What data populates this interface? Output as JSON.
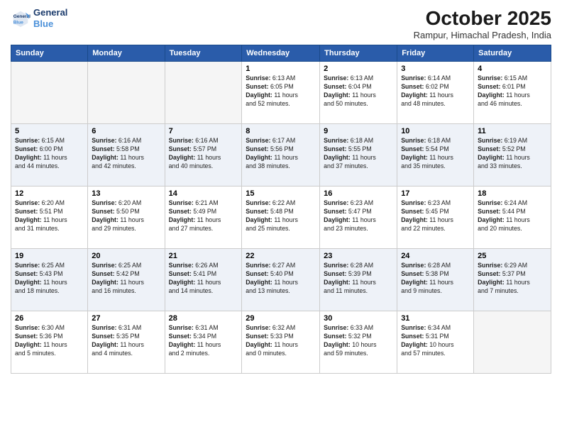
{
  "header": {
    "logo_line1": "General",
    "logo_line2": "Blue",
    "month": "October 2025",
    "location": "Rampur, Himachal Pradesh, India"
  },
  "weekdays": [
    "Sunday",
    "Monday",
    "Tuesday",
    "Wednesday",
    "Thursday",
    "Friday",
    "Saturday"
  ],
  "weeks": [
    [
      {
        "day": "",
        "content": ""
      },
      {
        "day": "",
        "content": ""
      },
      {
        "day": "",
        "content": ""
      },
      {
        "day": "1",
        "content": "Sunrise: 6:13 AM\nSunset: 6:05 PM\nDaylight: 11 hours\nand 52 minutes."
      },
      {
        "day": "2",
        "content": "Sunrise: 6:13 AM\nSunset: 6:04 PM\nDaylight: 11 hours\nand 50 minutes."
      },
      {
        "day": "3",
        "content": "Sunrise: 6:14 AM\nSunset: 6:02 PM\nDaylight: 11 hours\nand 48 minutes."
      },
      {
        "day": "4",
        "content": "Sunrise: 6:15 AM\nSunset: 6:01 PM\nDaylight: 11 hours\nand 46 minutes."
      }
    ],
    [
      {
        "day": "5",
        "content": "Sunrise: 6:15 AM\nSunset: 6:00 PM\nDaylight: 11 hours\nand 44 minutes."
      },
      {
        "day": "6",
        "content": "Sunrise: 6:16 AM\nSunset: 5:58 PM\nDaylight: 11 hours\nand 42 minutes."
      },
      {
        "day": "7",
        "content": "Sunrise: 6:16 AM\nSunset: 5:57 PM\nDaylight: 11 hours\nand 40 minutes."
      },
      {
        "day": "8",
        "content": "Sunrise: 6:17 AM\nSunset: 5:56 PM\nDaylight: 11 hours\nand 38 minutes."
      },
      {
        "day": "9",
        "content": "Sunrise: 6:18 AM\nSunset: 5:55 PM\nDaylight: 11 hours\nand 37 minutes."
      },
      {
        "day": "10",
        "content": "Sunrise: 6:18 AM\nSunset: 5:54 PM\nDaylight: 11 hours\nand 35 minutes."
      },
      {
        "day": "11",
        "content": "Sunrise: 6:19 AM\nSunset: 5:52 PM\nDaylight: 11 hours\nand 33 minutes."
      }
    ],
    [
      {
        "day": "12",
        "content": "Sunrise: 6:20 AM\nSunset: 5:51 PM\nDaylight: 11 hours\nand 31 minutes."
      },
      {
        "day": "13",
        "content": "Sunrise: 6:20 AM\nSunset: 5:50 PM\nDaylight: 11 hours\nand 29 minutes."
      },
      {
        "day": "14",
        "content": "Sunrise: 6:21 AM\nSunset: 5:49 PM\nDaylight: 11 hours\nand 27 minutes."
      },
      {
        "day": "15",
        "content": "Sunrise: 6:22 AM\nSunset: 5:48 PM\nDaylight: 11 hours\nand 25 minutes."
      },
      {
        "day": "16",
        "content": "Sunrise: 6:23 AM\nSunset: 5:47 PM\nDaylight: 11 hours\nand 23 minutes."
      },
      {
        "day": "17",
        "content": "Sunrise: 6:23 AM\nSunset: 5:45 PM\nDaylight: 11 hours\nand 22 minutes."
      },
      {
        "day": "18",
        "content": "Sunrise: 6:24 AM\nSunset: 5:44 PM\nDaylight: 11 hours\nand 20 minutes."
      }
    ],
    [
      {
        "day": "19",
        "content": "Sunrise: 6:25 AM\nSunset: 5:43 PM\nDaylight: 11 hours\nand 18 minutes."
      },
      {
        "day": "20",
        "content": "Sunrise: 6:25 AM\nSunset: 5:42 PM\nDaylight: 11 hours\nand 16 minutes."
      },
      {
        "day": "21",
        "content": "Sunrise: 6:26 AM\nSunset: 5:41 PM\nDaylight: 11 hours\nand 14 minutes."
      },
      {
        "day": "22",
        "content": "Sunrise: 6:27 AM\nSunset: 5:40 PM\nDaylight: 11 hours\nand 13 minutes."
      },
      {
        "day": "23",
        "content": "Sunrise: 6:28 AM\nSunset: 5:39 PM\nDaylight: 11 hours\nand 11 minutes."
      },
      {
        "day": "24",
        "content": "Sunrise: 6:28 AM\nSunset: 5:38 PM\nDaylight: 11 hours\nand 9 minutes."
      },
      {
        "day": "25",
        "content": "Sunrise: 6:29 AM\nSunset: 5:37 PM\nDaylight: 11 hours\nand 7 minutes."
      }
    ],
    [
      {
        "day": "26",
        "content": "Sunrise: 6:30 AM\nSunset: 5:36 PM\nDaylight: 11 hours\nand 5 minutes."
      },
      {
        "day": "27",
        "content": "Sunrise: 6:31 AM\nSunset: 5:35 PM\nDaylight: 11 hours\nand 4 minutes."
      },
      {
        "day": "28",
        "content": "Sunrise: 6:31 AM\nSunset: 5:34 PM\nDaylight: 11 hours\nand 2 minutes."
      },
      {
        "day": "29",
        "content": "Sunrise: 6:32 AM\nSunset: 5:33 PM\nDaylight: 11 hours\nand 0 minutes."
      },
      {
        "day": "30",
        "content": "Sunrise: 6:33 AM\nSunset: 5:32 PM\nDaylight: 10 hours\nand 59 minutes."
      },
      {
        "day": "31",
        "content": "Sunrise: 6:34 AM\nSunset: 5:31 PM\nDaylight: 10 hours\nand 57 minutes."
      },
      {
        "day": "",
        "content": ""
      }
    ]
  ]
}
